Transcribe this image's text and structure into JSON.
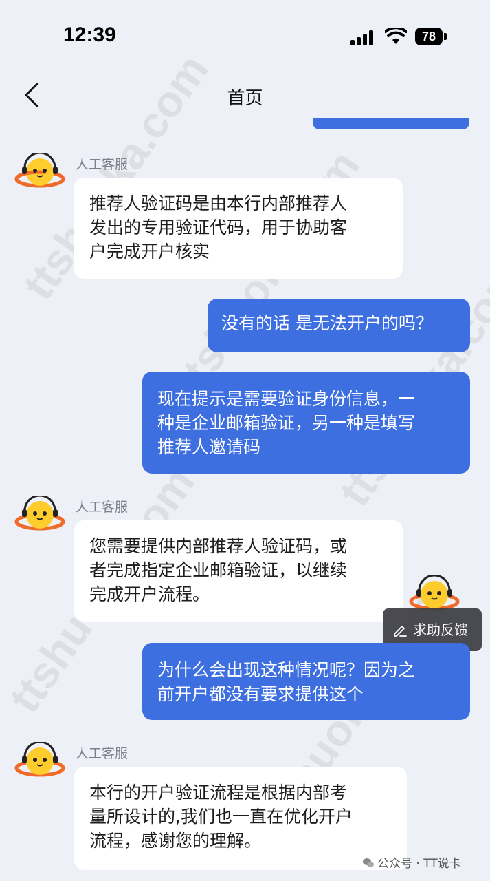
{
  "status_bar": {
    "time": "12:39",
    "battery": "78"
  },
  "nav": {
    "title": "首页"
  },
  "messages": [
    {
      "sender": "人工客服",
      "lines": [
        "推荐人验证码是由本行内部推荐人",
        "发出的专用验证代码，用于协助客",
        "户完成开户核实"
      ]
    },
    {
      "lines": [
        "没有的话 是无法开户的吗？"
      ]
    },
    {
      "lines": [
        "现在提示是需要验证身份信息，一",
        "种是企业邮箱验证，另一种是填写",
        "推荐人邀请码"
      ]
    },
    {
      "sender": "人工客服",
      "lines": [
        "您需要提供内部推荐人验证码，或",
        "者完成指定企业邮箱验证，以继续",
        "完成开户流程。"
      ]
    },
    {
      "lines": [
        "为什么会出现这种情况呢？因为之",
        "前开户都没有要求提供这个"
      ]
    },
    {
      "sender": "人工客服",
      "lines": [
        "本行的开户验证流程是根据内部考",
        "量所设计的,我们也一直在优化开户",
        "流程，感谢您的理解。"
      ]
    }
  ],
  "help_button": {
    "label": "求助反馈"
  },
  "footer": {
    "text": "公众号 · TT说卡"
  },
  "watermark": "ttshuoka.com TT说卡",
  "colors": {
    "accent": "#3d6fe0",
    "background": "#eef0f7",
    "agent_bubble": "#ffffff"
  },
  "icons": {
    "back": "chevron-left-icon",
    "avatar": "mascot-avatar",
    "edit": "pencil-icon",
    "wechat": "wechat-icon"
  }
}
